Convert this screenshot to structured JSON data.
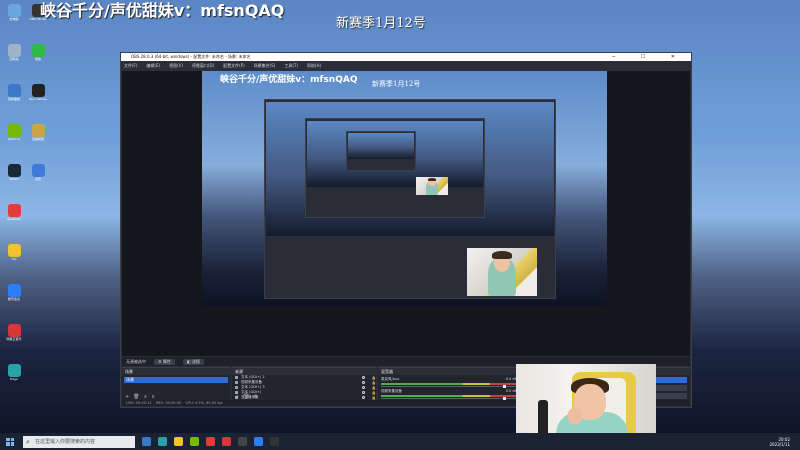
{
  "desktop": {
    "stream_title": "峡谷千分/声优甜妹v：mfsnQAQ",
    "season_text": "新赛季1月12号",
    "icons": [
      {
        "label": "此电脑",
        "color": "#6aa7e0"
      },
      {
        "label": "回收站",
        "color": "#9fb4c8"
      },
      {
        "label": "控制面板",
        "color": "#3b78c8"
      },
      {
        "label": "GeForce",
        "color": "#76b900"
      },
      {
        "label": "Steam",
        "color": "#1b2838"
      },
      {
        "label": "WeGame",
        "color": "#e23b3b"
      },
      {
        "label": "QQ",
        "color": "#f2c230"
      },
      {
        "label": "腾讯会议",
        "color": "#2d7ff9"
      },
      {
        "label": "网易云音乐",
        "color": "#d63737"
      },
      {
        "label": "Edge",
        "color": "#2aa3a8"
      },
      {
        "label": "OBS Studio",
        "color": "#333333"
      },
      {
        "label": "微信",
        "color": "#2fb94a"
      },
      {
        "label": "Epic Games",
        "color": "#222222"
      },
      {
        "label": "英雄联盟",
        "color": "#c9a44b"
      },
      {
        "label": "迅雷",
        "color": "#3f7ad8"
      }
    ]
  },
  "taskbar": {
    "search_placeholder": "在这里输入你要搜索的内容",
    "time": "20:02",
    "date": "2023/1/11",
    "apps": [
      "#3b78c8",
      "#2aa3a8",
      "#f2c230",
      "#76b900",
      "#e23b3b",
      "#d63737",
      "#444444",
      "#2d7ff9",
      "#333333"
    ]
  },
  "obs": {
    "window_title": "OBS 28.0.3 (64-bit, windows) - 配置文件: 未命名 - 场景: 未命名",
    "menus": [
      "文件(F)",
      "编辑(E)",
      "视图(V)",
      "停靠窗口(D)",
      "配置文件(P)",
      "场景集合(S)",
      "工具(T)",
      "帮助(H)"
    ],
    "control_bar": {
      "label": "无源被选中",
      "properties": "属性",
      "filters": "滤镜"
    },
    "scenes": {
      "title": "场景",
      "items": [
        "场景"
      ]
    },
    "sources": {
      "title": "来源",
      "items": [
        "文本 (GDI+) 2",
        "视频采集设备",
        "文本 (GDI+) 3",
        "文本 (GDI+)",
        "显示器采集"
      ]
    },
    "mixer": {
      "title": "混音器",
      "channels": [
        {
          "name": "麦克风/Aux",
          "level": "0.0 dB"
        },
        {
          "name": "视频采集设备",
          "level": "0.0 dB"
        },
        {
          "name": "桌面音频",
          "level": "0.0 dB"
        }
      ]
    },
    "transitions": {
      "title": "转场特效",
      "type": "淡出",
      "duration_label": "时长",
      "duration": "300 ms"
    },
    "controls": {
      "title": "控制",
      "stop_streaming": "停止推流",
      "start_recording": "开始录制",
      "virtual_camera": "启动虚拟摄像机",
      "studio_mode": "工作室模式",
      "settings": "设置",
      "exit": "退出"
    },
    "status": {
      "live": "LIVE: 00:45:12",
      "rec": "REC: 00:00:00",
      "cpu": "CPU: 4.5%, 60.00 fps"
    }
  }
}
